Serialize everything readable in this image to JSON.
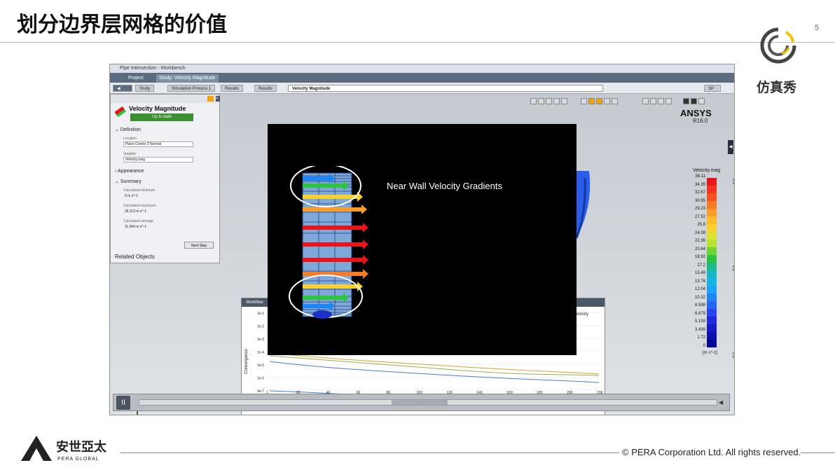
{
  "slide": {
    "title": "划分边界层网格的价值",
    "page_number": "5",
    "brand_text": "仿真秀",
    "copyright": "©  PERA Corporation Ltd. All rights reserved.",
    "pera_name": "安世亞太",
    "pera_sub": "PERA GLOBAL"
  },
  "workbench": {
    "window_title": "Pipe Intersection - Workbench",
    "tabs": [
      "Project",
      "Study: Velocity Magnitude"
    ],
    "breadcrumbs": [
      "Study",
      "Simulation Process 1",
      "Results",
      "Results",
      "Velocity Magnitude"
    ],
    "zoom": "SP 0",
    "properties": {
      "title": "Velocity Magnitude",
      "status": "Up to date",
      "definition": "Definition",
      "location_label": "Location",
      "location_value": "Plane Centre Z Normal",
      "variable_label": "Variable",
      "variable_value": "Velocity.mag",
      "appearance": "Appearance",
      "summary": "Summary",
      "min_label": "Calculated minimum",
      "min_value": "0 m s^-1",
      "max_label": "Calculated maximum",
      "max_value": "36.113 m s^-1",
      "avg_label": "Calculated average",
      "avg_value": "11.564 m s^-1",
      "next_step": "Next Step",
      "related": "Related Objects"
    },
    "ansys": "ANSYS",
    "ansys_version": "R16.0",
    "legend": {
      "title": "Velocity.mag",
      "unit": "[m s^-1]",
      "values": [
        "36.11",
        "34.39",
        "32.67",
        "30.95",
        "29.23",
        "27.52",
        "25.8",
        "24.08",
        "22.36",
        "20.64",
        "18.92",
        "17.2",
        "15.48",
        "13.76",
        "12.04",
        "10.32",
        "8.598",
        "6.879",
        "5.159",
        "3.439",
        "1.72",
        "0"
      ],
      "colors": [
        "#e8141a",
        "#f0341d",
        "#f45321",
        "#f77a24",
        "#fa9c27",
        "#fdbd2a",
        "#f8d12e",
        "#e0e031",
        "#b8e335",
        "#6fd43a",
        "#2fc43f",
        "#1bb88a",
        "#17b8c4",
        "#14b6e6",
        "#18a6f4",
        "#1e86f4",
        "#2466f4",
        "#2a44f2",
        "#2028e0",
        "#1519c7",
        "#0d0fae",
        "#060895"
      ],
      "axis_ticks": [
        "0.35",
        "0.3",
        "0.25",
        "0.2",
        "0.15",
        "0.1",
        "0.05",
        "0"
      ]
    },
    "workflow": {
      "title": "Workflow",
      "legend_text": "elocity",
      "ylabel": "Convergence",
      "y_ticks": [
        "1e-1",
        "1e-2",
        "1e-3",
        "1e-4",
        "1e-5",
        "1e-6",
        "3e-7"
      ],
      "x_ticks": [
        "1",
        "20",
        "40",
        "60",
        "80",
        "100",
        "120",
        "140",
        "160",
        "180",
        "200",
        "218"
      ]
    },
    "video": {
      "title": "Near Wall Velocity Gradients"
    },
    "player": {
      "pause": "II"
    }
  }
}
